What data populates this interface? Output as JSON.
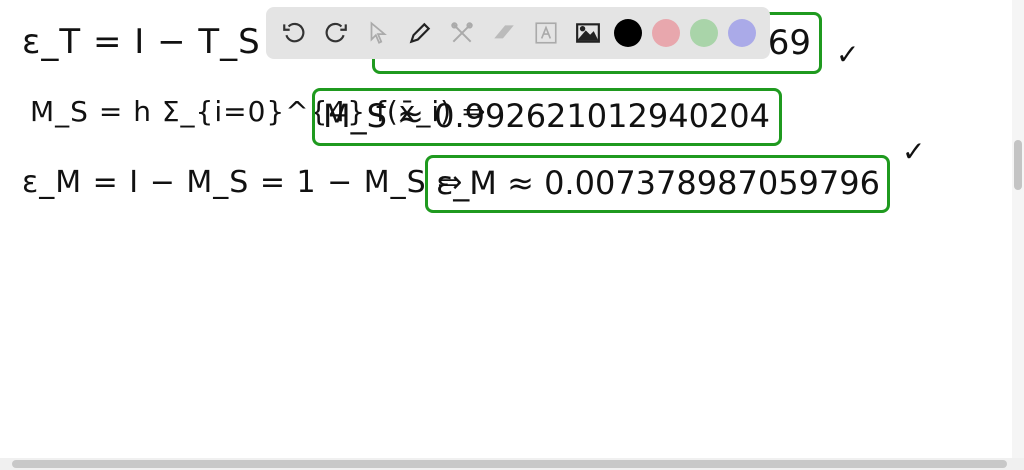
{
  "whiteboard": {
    "line1": {
      "lhs": "ε_T = I − T_S = 1 − T",
      "result": "…269"
    },
    "line2": {
      "lhs": "M_S = h Σ_{i=0}^{4} f(x̄_i) ⇒",
      "result": "M_S ≈ 0.99262101294020​4"
    },
    "line3": {
      "lhs": "ε_M = I − M_S = 1 − M_S ⇒",
      "result": "ε_M ≈ 0.0073789870597​96"
    },
    "checkmark": "✓"
  },
  "toolbar": {
    "tools": [
      "undo-icon",
      "redo-icon",
      "select-icon",
      "pen-icon",
      "tools-icon",
      "eraser-icon",
      "text-icon",
      "image-icon"
    ],
    "colors": [
      "#000000",
      "#e8a7ad",
      "#a9d4a9",
      "#aaaae8"
    ]
  }
}
